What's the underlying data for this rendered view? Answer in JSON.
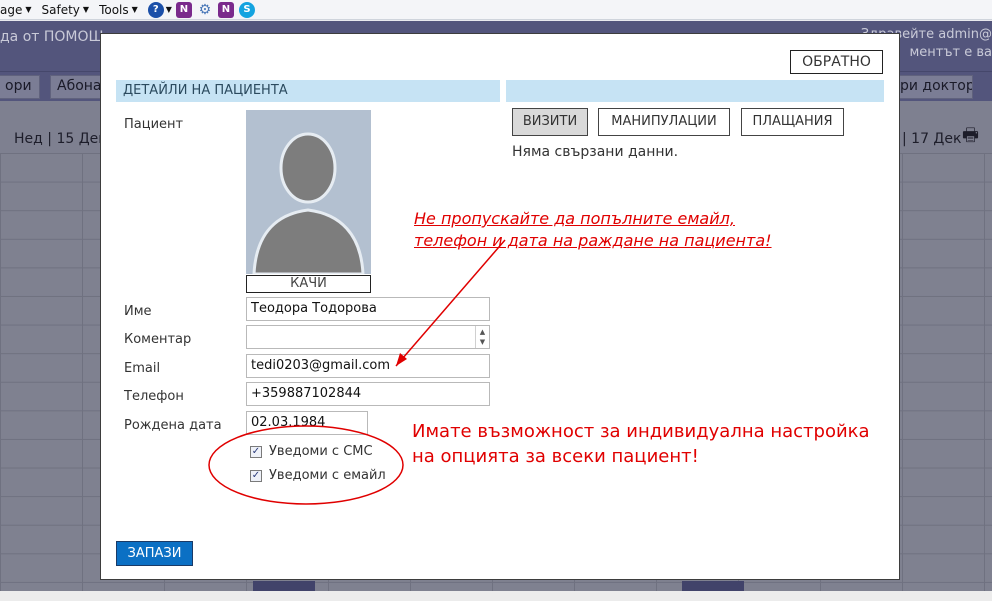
{
  "browser_bar": {
    "menu_page": "age",
    "menu_safety": "Safety",
    "menu_tools": "Tools",
    "dropdown_glyph": "▼",
    "icon_help_glyph": "?",
    "icon_onenote_glyph": "N",
    "icon_settings_glyph": "⚙",
    "icon_skype_glyph": "S"
  },
  "background_app": {
    "header_left": "да от ПОМОЩ",
    "header_right_1": "Здравейте admin@",
    "header_right_2": "ментът е ва",
    "nav_left_1": "ори",
    "nav_left_2": "Абона",
    "nav_right": "ри доктор",
    "date_left": "Нед | 15 Дек",
    "date_right": "| 17 Дек",
    "print_glyph": "🖶"
  },
  "modal": {
    "back_label": "ОБРАТНО",
    "section_details_title": "ДЕТАЙЛИ НА ПАЦИЕНТА",
    "section_right_title": "",
    "labels": {
      "patient": "Пациент",
      "name": "Име",
      "comment": "Коментар",
      "email": "Email",
      "phone": "Телефон",
      "birthdate": "Рождена дата"
    },
    "upload_label": "КАЧИ",
    "fields": {
      "name": "Теодора Тодорова",
      "comment": "",
      "email": "tedi0203@gmail.com",
      "phone": "+359887102844",
      "birthdate": "02.03.1984"
    },
    "spin_up": "▲",
    "spin_down": "▼",
    "checks": {
      "sms_label": "Уведоми с СМС",
      "email_label": "Уведоми с емайл",
      "mark": "✓",
      "sms_checked": true,
      "email_checked": true
    },
    "tabs": [
      {
        "label": "ВИЗИТИ",
        "active": true
      },
      {
        "label": "МАНИПУЛАЦИИ",
        "active": false
      },
      {
        "label": "ПЛАЩАНИЯ",
        "active": false
      }
    ],
    "no_data": "Няма свързани данни.",
    "save_label": "ЗАПАЗИ"
  },
  "annotations": {
    "note_top_line1": "Не пропускайте да попълните емайл,",
    "note_top_line2": "телефон и дата на раждане на пациента!",
    "note_bottom_line1": "Имате възможност за индивидуална настройка",
    "note_bottom_line2": "на опцията за всеки пациент!"
  },
  "colors": {
    "accent": "#0b70c4",
    "section_header": "#c6e3f4",
    "annotation": "#e00000",
    "overlay_header": "#53557c"
  }
}
